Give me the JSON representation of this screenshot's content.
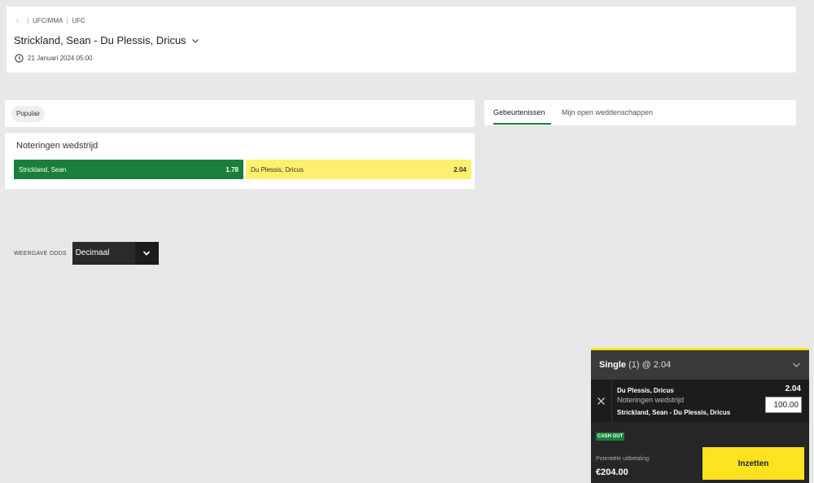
{
  "breadcrumb": {
    "level1": "UFC/MMA",
    "level2": "UFC"
  },
  "event": {
    "title": "Strickland, Sean - Du Plessis, Dricus",
    "datetime": "21 Januari 2024 05:00"
  },
  "popular_chip": "Populair",
  "market": {
    "title": "Noteringen wedstrijd",
    "home": {
      "name": "Strickland, Sean",
      "price": "1.78"
    },
    "away": {
      "name": "Du Plessis, Dricus",
      "price": "2.04"
    }
  },
  "tabs": [
    {
      "label": "Gebeurtenissen",
      "active": true
    },
    {
      "label": "Mijn open weddenschappen",
      "active": false
    }
  ],
  "odds_format": {
    "label": "WEERGAVE ODDS",
    "value": "Decimaal"
  },
  "betslip": {
    "type_label": "Single",
    "type_detail": "(1) @ 2.04",
    "selection": "Du Plessis, Dricus",
    "market": "Noteringen wedstrijd",
    "event": "Strickland, Sean - Du Plessis, Dricus",
    "price": "2.04",
    "stake": "100.00",
    "cashout": "CASH OUT",
    "payout_label": "Potentiële uitbetaling:",
    "payout_value": "€204.00",
    "place_label": "Inzetten"
  },
  "colors": {
    "accent_green": "#1a7f3c",
    "accent_yellow": "#ffe21f",
    "away_odd_bg": "#fdf06c"
  }
}
